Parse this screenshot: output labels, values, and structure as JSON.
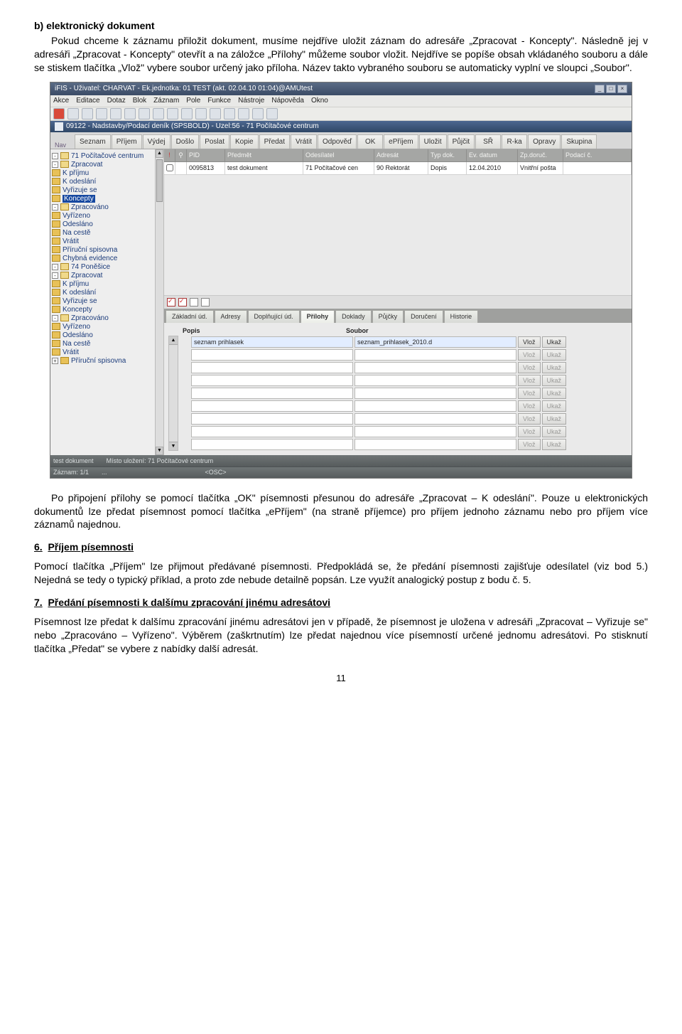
{
  "doc": {
    "h_b": "b) elektronický dokument",
    "p1": "Pokud chceme k záznamu přiložit dokument, musíme nejdříve uložit záznam do adresáře „Zpracovat - Koncepty\". Následně jej v adresáři „Zpracovat - Koncepty\" otevřít a na záložce „Přílohy\" můžeme soubor vložit. Nejdříve se popíše obsah vkládaného souboru a dále se stiskem tlačítka „Vlož\" vybere soubor určený jako příloha. Název takto vybraného souboru se automaticky vyplní ve sloupci „Soubor\".",
    "p2": "Po připojení přílohy se pomocí tlačítka „OK\" písemnosti přesunou do adresáře „Zpracovat – K odeslání\". Pouze u elektronických dokumentů lze předat písemnost pomocí tlačítka „ePříjem\" (na straně příjemce) pro příjem jednoho záznamu nebo pro příjem více záznamů najednou.",
    "s6_num": "6.",
    "s6_title": "Příjem písemnosti",
    "p3": "Pomocí tlačítka „Příjem\" lze přijmout předávané písemnosti. Předpokládá se, že předání písemnosti zajišťuje odesílatel (viz bod 5.) Nejedná se tedy o typický příklad, a proto zde nebude detailně popsán. Lze využít analogický postup z bodu č. 5.",
    "s7_num": "7.",
    "s7_title": "Předání písemnosti k dalšímu zpracování jinému adresátovi",
    "p4": "Písemnost lze předat k dalšímu zpracování jinému adresátovi jen v případě, že písemnost je uložena v adresáři „Zpracovat – Vyřizuje se\" nebo „Zpracováno – Vyřízeno\". Výběrem (zaškrtnutím) lze předat najednou více písemností určené jednomu adresátovi. Po stisknutí tlačítka „Předat\" se vybere z nabídky další adresát.",
    "page": "11"
  },
  "app": {
    "title": "iFIS - Uživatel: CHARVAT - Ek.jednotka: 01 TEST (akt. 02.04.10 01:04)@AMUtest",
    "menu": [
      "Akce",
      "Editace",
      "Dotaz",
      "Blok",
      "Záznam",
      "Pole",
      "Funkce",
      "Nástroje",
      "Nápověda",
      "Okno"
    ],
    "subtitle": "09122 - Nadstavby/Podací deník (SPSBOLD) - Uzel:56 - 71 Počítačové centrum",
    "nav": "Nav",
    "tabs": [
      "Seznam",
      "Příjem",
      "Výdej",
      "Došlo",
      "Poslat",
      "Kopie",
      "Předat",
      "Vrátit",
      "Odpověď",
      "OK",
      "ePříjem",
      "Uložit",
      "Půjčit",
      "SŘ",
      "R-ka",
      "Opravy",
      "Skupina"
    ],
    "tree": [
      {
        "lvl": 1,
        "pm": "-",
        "label": "71 Počítačové centrum"
      },
      {
        "lvl": 2,
        "pm": "-",
        "label": "Zpracovat"
      },
      {
        "lvl": 3,
        "label": "K příjmu"
      },
      {
        "lvl": 3,
        "label": "K odeslání"
      },
      {
        "lvl": 3,
        "label": "Vyřizuje se"
      },
      {
        "lvl": 3,
        "label": "Koncepty",
        "sel": true
      },
      {
        "lvl": 2,
        "pm": "-",
        "label": "Zpracováno"
      },
      {
        "lvl": 3,
        "label": "Vyřízeno"
      },
      {
        "lvl": 3,
        "label": "Odesláno"
      },
      {
        "lvl": 2,
        "label": "Na cestě"
      },
      {
        "lvl": 2,
        "label": "Vrátit"
      },
      {
        "lvl": 2,
        "label": "Příruční spisovna"
      },
      {
        "lvl": 2,
        "label": "Chybná evidence"
      },
      {
        "lvl": 1,
        "pm": "-",
        "label": "74 Poněšice"
      },
      {
        "lvl": 2,
        "pm": "-",
        "label": "Zpracovat"
      },
      {
        "lvl": 3,
        "label": "K příjmu"
      },
      {
        "lvl": 3,
        "label": "K odeslání"
      },
      {
        "lvl": 3,
        "label": "Vyřizuje se"
      },
      {
        "lvl": 3,
        "label": "Koncepty"
      },
      {
        "lvl": 2,
        "pm": "-",
        "label": "Zpracováno"
      },
      {
        "lvl": 3,
        "label": "Vyřízeno"
      },
      {
        "lvl": 3,
        "label": "Odesláno"
      },
      {
        "lvl": 2,
        "label": "Na cestě"
      },
      {
        "lvl": 2,
        "label": "Vrátit"
      },
      {
        "lvl": 2,
        "pm": "+",
        "label": "Příruční spisovna"
      }
    ],
    "gridcols": {
      "excl": "!",
      "pin": "⚲",
      "pid": "PID",
      "predmet": "Předmět",
      "odes": "Odesílatel",
      "adr": "Adresát",
      "typ": "Typ dok.",
      "ev": "Ev. datum",
      "zp": "Zp.doruč.",
      "pod": "Podací č."
    },
    "gridrow": {
      "pid": "0095813",
      "predmet": "test dokument",
      "odes": "71 Počítačové cen",
      "adr": "90 Rektorát",
      "typ": "Dopis",
      "ev": "12.04.2010",
      "zp": "Vnitřní pošta",
      "pod": ""
    },
    "dettabs": [
      "Základní úd.",
      "Adresy",
      "Doplňující úd.",
      "Přílohy",
      "Doklady",
      "Půjčky",
      "Doručení",
      "Historie"
    ],
    "detactive": 3,
    "detcols": {
      "popis": "Popis",
      "soubor": "Soubor"
    },
    "attach_first": {
      "popis": "seznam prihlasek",
      "soubor": "seznam_prihlasek_2010.d"
    },
    "btn_vloz": "Vlož",
    "btn_ukaz": "Ukaž",
    "status1": {
      "a": "test dokument",
      "b": "Místo uložení: 71 Počítačové centrum"
    },
    "status2": {
      "a": "Záznam: 1/1",
      "b": "...",
      "c": "<OSC>"
    }
  }
}
